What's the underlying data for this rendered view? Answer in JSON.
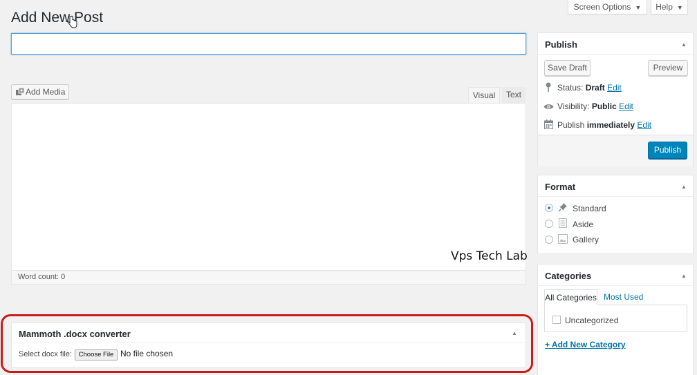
{
  "header": {
    "screen_options": "Screen Options",
    "help": "Help",
    "page_title": "Add New Post"
  },
  "editor": {
    "title_value": "",
    "add_media": "Add Media",
    "tab_visual": "Visual",
    "tab_text": "Text",
    "word_count": "Word count: 0",
    "watermark": "Vps Tech Lab"
  },
  "mammoth": {
    "title": "Mammoth .docx converter",
    "select_label": "Select docx file:",
    "choose_file": "Choose File",
    "no_file": "No file chosen"
  },
  "publish": {
    "title": "Publish",
    "save_draft": "Save Draft",
    "preview": "Preview",
    "status_label": "Status:",
    "status_value": "Draft",
    "visibility_label": "Visibility:",
    "visibility_value": "Public",
    "publish_label": "Publish",
    "publish_value": "immediately",
    "edit": "Edit",
    "publish_button": "Publish"
  },
  "format": {
    "title": "Format",
    "options": [
      {
        "label": "Standard",
        "icon": "pushpin-icon",
        "selected": true
      },
      {
        "label": "Aside",
        "icon": "document-icon",
        "selected": false
      },
      {
        "label": "Gallery",
        "icon": "image-icon",
        "selected": false
      }
    ]
  },
  "categories": {
    "title": "Categories",
    "tab_all": "All Categories",
    "tab_most_used": "Most Used",
    "items": [
      "Uncategorized"
    ],
    "add_new": "+ Add New Category"
  },
  "colors": {
    "accent": "#0073aa",
    "primary_button": "#0085ba",
    "highlight_outline": "#cc1b1b"
  }
}
